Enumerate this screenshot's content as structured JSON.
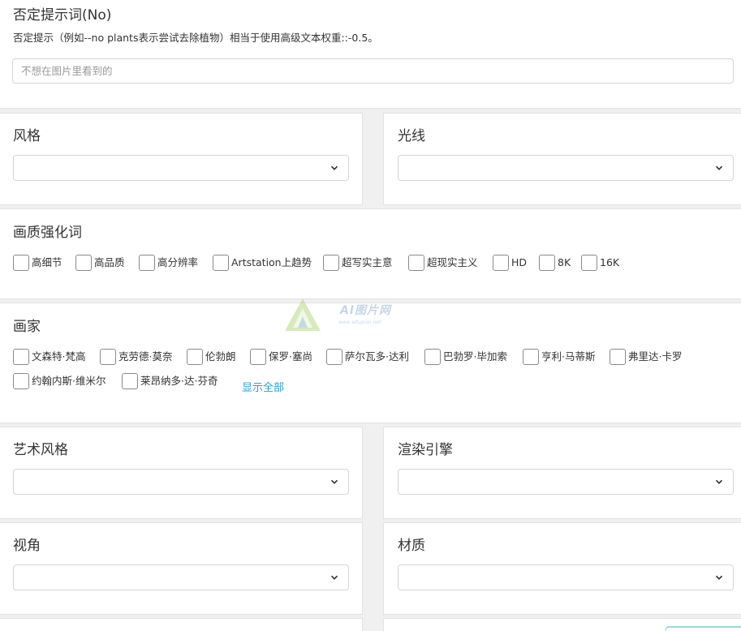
{
  "negative": {
    "title": "否定提示词(No)",
    "hint": "否定提示（例如--no plants表示尝试去除植物）相当于使用高级文本权重::-0.5。",
    "placeholder": "不想在图片里看到的"
  },
  "style": {
    "title": "风格"
  },
  "lighting": {
    "title": "光线"
  },
  "quality": {
    "title": "画质强化词",
    "options": [
      "高细节",
      "高品质",
      "高分辨率",
      "Artstation上趋势",
      "超写实主意",
      "超现实主义",
      "HD",
      "8K",
      "16K"
    ]
  },
  "artists": {
    "title": "画家",
    "options": [
      "文森特·梵高",
      "克劳德·莫奈",
      "伦勃朗",
      "保罗·塞尚",
      "萨尔瓦多·达利",
      "巴勃罗·毕加索",
      "亨利·马蒂斯",
      "弗里达·卡罗",
      "约翰内斯·维米尔",
      "莱昂纳多·达·芬奇"
    ],
    "show_all": "显示全部"
  },
  "art_style": {
    "title": "艺术风格"
  },
  "render_engine": {
    "title": "渲染引擎"
  },
  "view_angle": {
    "title": "视角"
  },
  "material": {
    "title": "材质"
  },
  "watermark": {
    "text": "AI图片网",
    "sub": "www.aitupian.net"
  },
  "icons": {
    "select_arrow": "chevron-down-icon",
    "checkbox": "checkbox-icon",
    "watermark_logo": "triangle-logo-icon"
  }
}
